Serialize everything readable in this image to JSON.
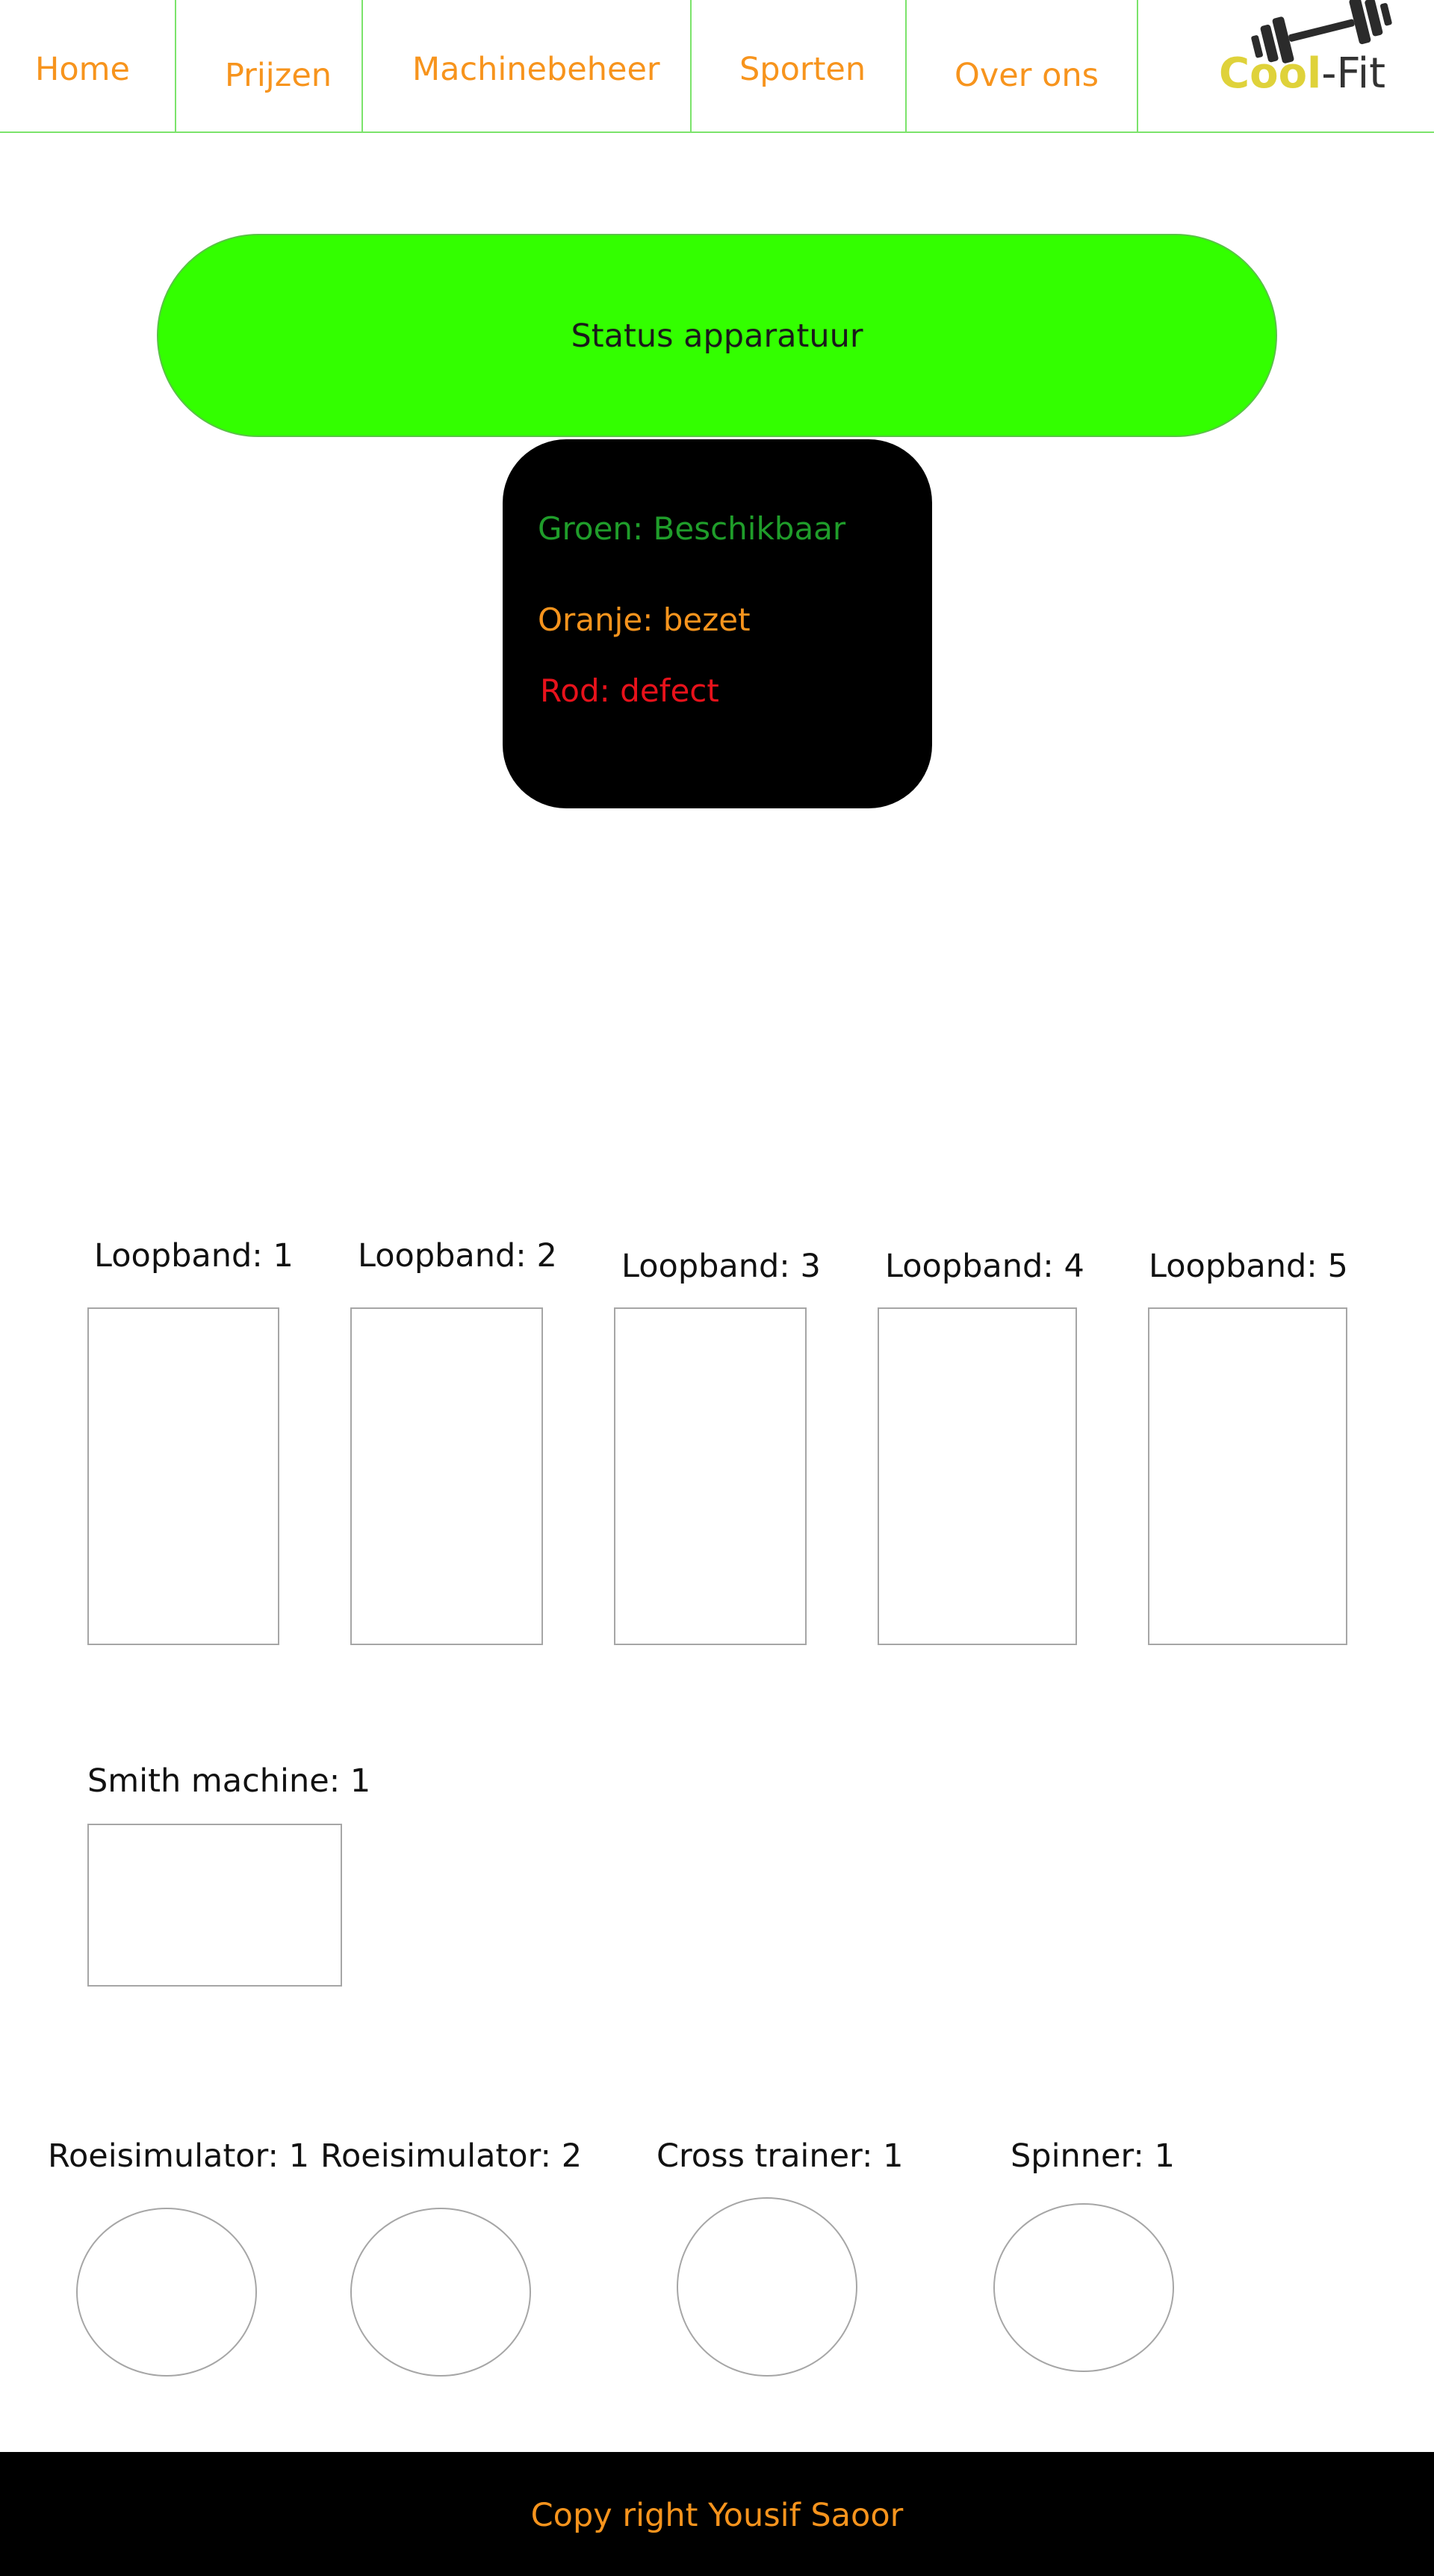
{
  "nav": {
    "items": [
      {
        "label": "Home"
      },
      {
        "label": "Prijzen"
      },
      {
        "label": "Machinebeheer"
      },
      {
        "label": "Sporten"
      },
      {
        "label": "Over ons"
      }
    ],
    "logo": {
      "part1": "Cool",
      "part2": "-Fit"
    }
  },
  "status": {
    "title": "Status apparatuur",
    "legend": [
      {
        "text": "Groen: Beschikbaar",
        "color": "#1f9d2a"
      },
      {
        "text": "Oranje: bezet",
        "color": "#f7941d"
      },
      {
        "text": "Rod: defect",
        "color": "#e8121b"
      }
    ]
  },
  "machines": {
    "treadmills": [
      {
        "label": "Loopband: 1"
      },
      {
        "label": "Loopband: 2"
      },
      {
        "label": "Loopband: 3"
      },
      {
        "label": "Loopband: 4"
      },
      {
        "label": "Loopband: 5"
      }
    ],
    "smith": {
      "label": "Smith machine: 1"
    },
    "round": [
      {
        "label": "Roeisimulator: 1"
      },
      {
        "label": "Roeisimulator: 2"
      },
      {
        "label": "Cross trainer: 1"
      },
      {
        "label": "Spinner: 1"
      }
    ]
  },
  "footer": {
    "text": "Copy right Yousif Saoor"
  },
  "colors": {
    "accent": "#f7941d",
    "nav_border": "#7be36b",
    "status_bg": "#33ff00"
  }
}
